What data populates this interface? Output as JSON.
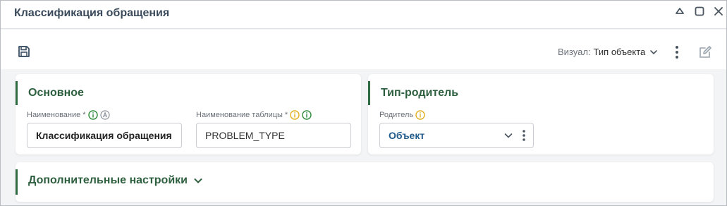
{
  "window": {
    "title": "Классификация обращения",
    "controls": [
      "minimize-icon",
      "maximize-icon",
      "close-icon"
    ]
  },
  "toolbar": {
    "save_icon": "save-icon",
    "visual_label": "Визуал:",
    "visual_value": "Тип объекта",
    "more_icon": "more-vertical-icon",
    "edit_icon": "edit-icon"
  },
  "main": {
    "title": "Основное",
    "name_label": "Наименование",
    "name_required": "*",
    "name_value": "Классификация обращения",
    "table_label": "Наименование таблицы",
    "table_required": "*",
    "table_value": "PROBLEM_TYPE"
  },
  "parent": {
    "title": "Тип-родитель",
    "parent_label": "Родитель",
    "parent_value": "Объект"
  },
  "extra": {
    "title": "Дополнительные настройки"
  },
  "colors": {
    "accent_green": "#2e6b43",
    "info_green": "#2e8b3a",
    "info_yellow": "#e0b020",
    "link_blue": "#1f5a8a"
  }
}
